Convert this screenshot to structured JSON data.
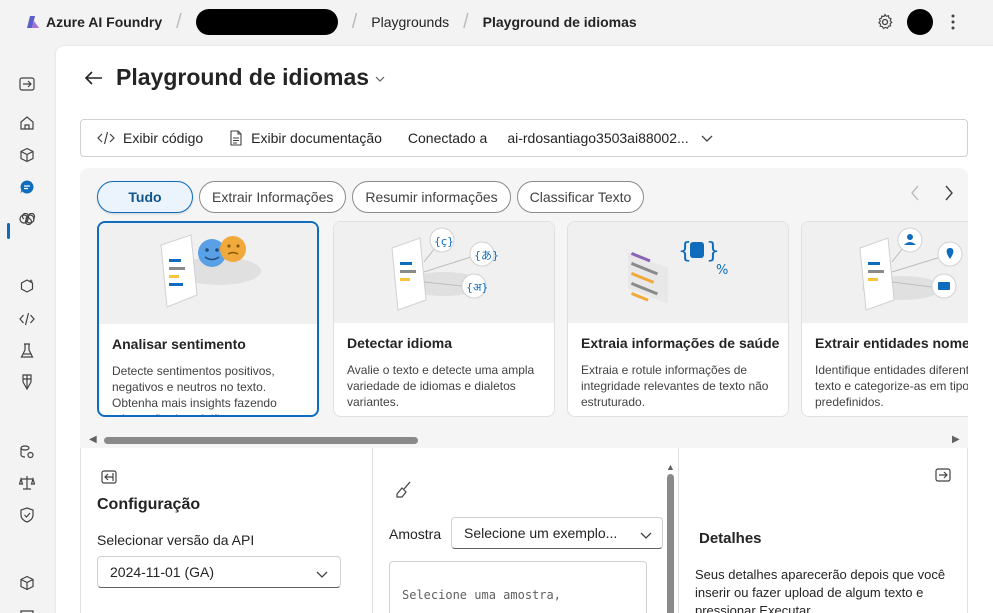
{
  "header": {
    "brand": "Azure AI Foundry",
    "crumbs": [
      "Playgrounds",
      "Playground de idiomas"
    ],
    "icons": [
      "settings-icon",
      "avatar",
      "more-icon"
    ]
  },
  "rail": {
    "items": [
      "collapse-nav-icon",
      "home-icon",
      "model-catalog-icon",
      "playgrounds-icon",
      "agents-icon",
      "ai-services-icon",
      "code-icon",
      "evaluation-icon",
      "fine-tuning-icon",
      "data-icon",
      "governance-icon",
      "guardrails-icon",
      "management-icon",
      "models-icon"
    ],
    "active": "playgrounds-icon"
  },
  "page": {
    "title": "Playground de idiomas"
  },
  "toolbar": {
    "view_code": "Exibir código",
    "view_docs": "Exibir documentação",
    "connected_label": "Conectado a",
    "connected_value": "ai-rdosantiago3503ai88002..."
  },
  "gallery": {
    "filters": [
      {
        "label": "Tudo",
        "active": true
      },
      {
        "label": "Extrair Informações",
        "active": false
      },
      {
        "label": "Resumir informações",
        "active": false
      },
      {
        "label": "Classificar Texto",
        "active": false
      }
    ],
    "cards": [
      {
        "title": "Analisar sentimento",
        "desc": "Detecte sentimentos positivos, negativos e neutros no texto. Obtenha mais insights fazendo mineração de opiniões.",
        "selected": true
      },
      {
        "title": "Detectar idioma",
        "desc": "Avalie o texto e detecte uma ampla variedade de idiomas e dialetos variantes.",
        "selected": false
      },
      {
        "title": "Extraia informações de saúde",
        "desc": "Extraia e rotule informações de integridade relevantes de texto não estruturado.",
        "selected": false
      },
      {
        "title": "Extrair entidades nomeadas",
        "desc": "Identifique entidades diferentes no texto e categorize-as em tipos predefinidos.",
        "selected": false
      }
    ]
  },
  "config": {
    "title": "Configuração",
    "api_label": "Selecionar versão da API",
    "api_value": "2024-11-01 (GA)"
  },
  "sample": {
    "label": "Amostra",
    "select_value": "Selecione um exemplo...",
    "textarea_placeholder": "Selecione uma amostra,"
  },
  "details": {
    "title": "Detalhes",
    "text": "Seus detalhes aparecerão depois que você inserir ou fazer upload de algum texto e pressionar Executar."
  },
  "colors": {
    "accent": "#0f6cbd",
    "accent_bg": "#ebf3fc",
    "text": "#242424"
  }
}
